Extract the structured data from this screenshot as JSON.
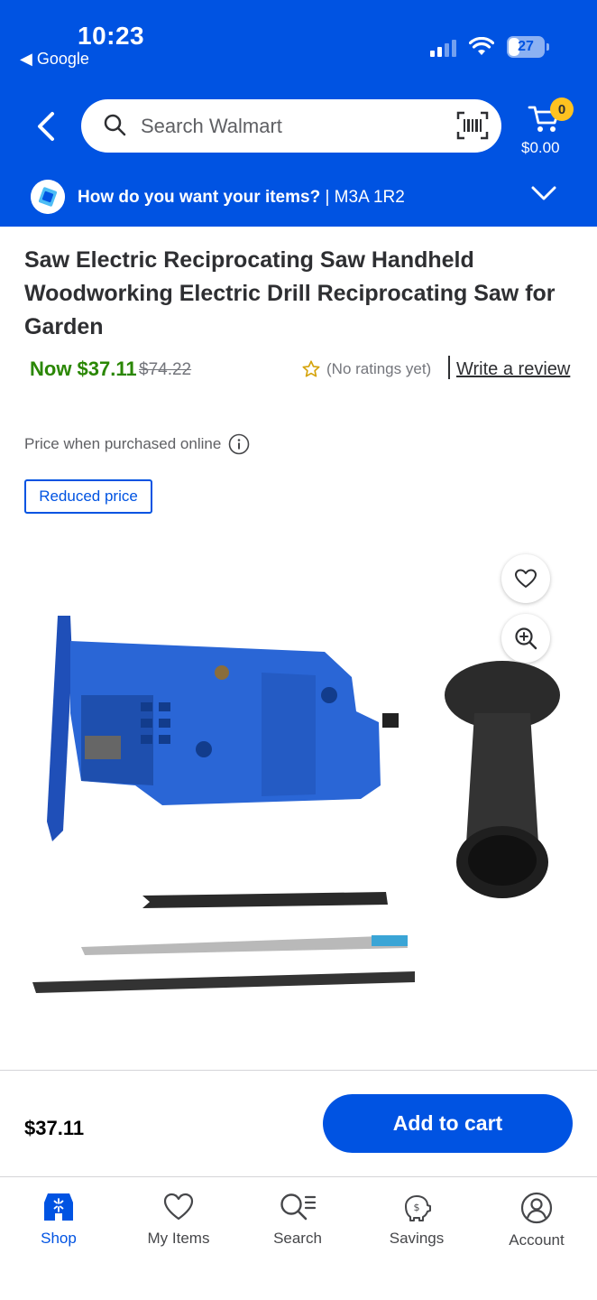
{
  "status_bar": {
    "time": "10:23",
    "back_app": "◀ Google",
    "battery": "27"
  },
  "header": {
    "search_placeholder": "Search Walmart",
    "cart_count": "0",
    "cart_total": "$0.00",
    "delivery_question": "How do you want your items?",
    "delivery_location": " | M3A 1R2",
    "brand_color": "#0053e2",
    "accent_color": "#ffc220"
  },
  "product": {
    "title": "Saw Electric Reciprocating Saw Handheld Woodworking Electric Drill Reciprocating Saw for Garden",
    "now_price": "Now $37.11",
    "was_price": "$74.22",
    "rating_text": "(No ratings yet)",
    "write_review": "Write a review",
    "online_note": "Price when purchased online",
    "reduced_tag": "Reduced price",
    "price_color": "#2a8703"
  },
  "bottom_bar": {
    "price": "$37.11",
    "add_to_cart": "Add to cart"
  },
  "tabs": [
    {
      "label": "Shop",
      "icon": "shop-icon",
      "active": true
    },
    {
      "label": "My Items",
      "icon": "heart-icon",
      "active": false
    },
    {
      "label": "Search",
      "icon": "search-icon",
      "active": false
    },
    {
      "label": "Savings",
      "icon": "savings-icon",
      "active": false
    },
    {
      "label": "Account",
      "icon": "account-icon",
      "active": false
    }
  ]
}
